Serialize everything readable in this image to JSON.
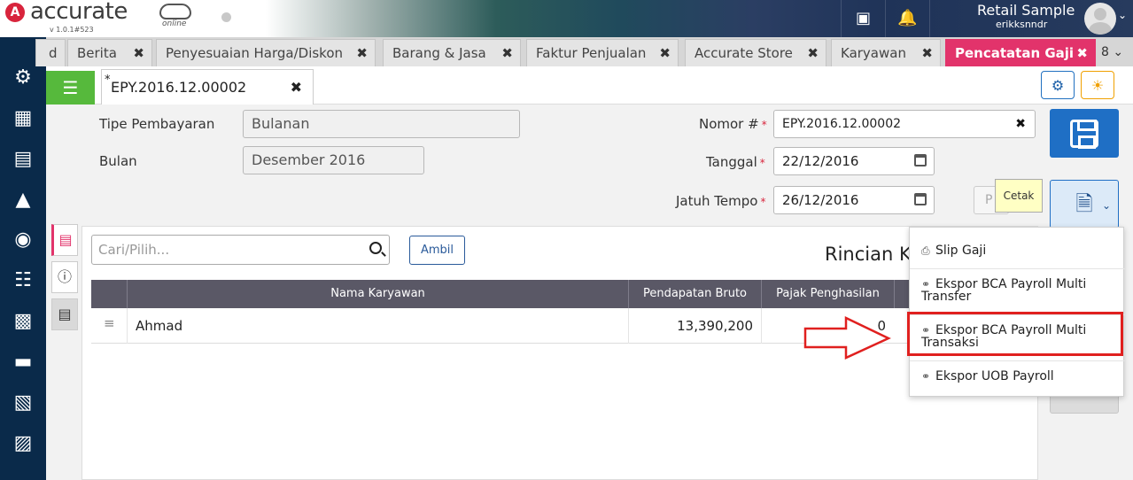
{
  "app": {
    "brand": "accurate",
    "brand_sub": "online",
    "version": "v 1.0.1#523",
    "user_name": "Retail Sample",
    "user_id": "erikksnndr"
  },
  "tabs": [
    {
      "label": "d"
    },
    {
      "label": "Berita"
    },
    {
      "label": "Penyesuaian Harga/Diskon"
    },
    {
      "label": "Barang & Jasa"
    },
    {
      "label": "Faktur Penjualan"
    },
    {
      "label": "Accurate Store"
    },
    {
      "label": "Karyawan"
    },
    {
      "label": "Pencatatan Gaji",
      "active": true
    }
  ],
  "tabs_more": "8",
  "doc_tab": {
    "star": "*",
    "label": "EPY.2016.12.00002"
  },
  "form": {
    "tipe_label": "Tipe Pembayaran",
    "tipe_value": "Bulanan",
    "bulan_label": "Bulan",
    "bulan_value": "Desember 2016",
    "nomor_label": "Nomor #",
    "nomor_value": "EPY.2016.12.00002",
    "tanggal_label": "Tanggal",
    "tanggal_value": "22/12/2016",
    "jatuh_label": "Jatuh Tempo",
    "jatuh_value": "26/12/2016",
    "required_mark": "*",
    "ghost_label": "P"
  },
  "tooltip": "Cetak",
  "panel": {
    "search_placeholder": "Cari/Pilih...",
    "ambil_label": "Ambil",
    "title": "Rincian Ka"
  },
  "table": {
    "headers": [
      "Nama Karyawan",
      "Pendapatan Bruto",
      "Pajak Penghasilan"
    ],
    "rows": [
      {
        "name": "Ahmad",
        "bruto": "13,390,200",
        "pajak": "0"
      }
    ]
  },
  "menu": {
    "items": [
      {
        "label": "Slip Gaji",
        "icon": "printer-icon"
      },
      {
        "label": "Ekspor BCA Payroll Multi Transfer",
        "icon": "share-icon"
      },
      {
        "label": "Ekspor BCA Payroll Multi Transaksi",
        "icon": "share-icon"
      },
      {
        "label": "Ekspor UOB Payroll",
        "icon": "share-icon"
      }
    ]
  },
  "colors": {
    "active_tab": "#e2336b",
    "sidebar": "#0a2a4a",
    "primary": "#1f6fc5",
    "green": "#56b93c",
    "highlight": "#e0201f"
  }
}
